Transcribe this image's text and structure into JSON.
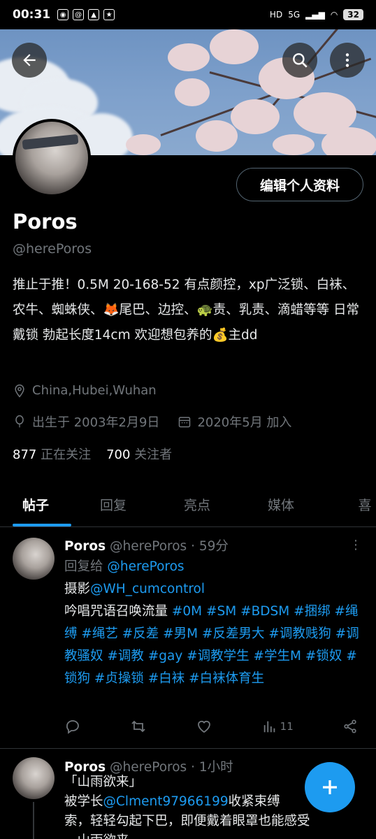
{
  "status_bar": {
    "time": "00:31",
    "network": "5G",
    "battery": "32"
  },
  "profile": {
    "edit_label": "编辑个人资料",
    "name": "Poros",
    "handle": "@herePoros",
    "bio": "推止于推！0.5M 20-168-52 有点颜控，xp广泛锁、白袜、农牛、蜘蛛侠、🦊尾巴、边控、🐢责、乳责、滴蜡等等 日常戴锁 勃起长度14cm 欢迎想包养的💰主dd",
    "location": "China,Hubei,Wuhan",
    "birthday": "出生于 2003年2月9日",
    "joined": "2020年5月 加入",
    "following_count": "877",
    "following_label": "正在关注",
    "followers_count": "700",
    "followers_label": "关注者"
  },
  "tabs": [
    {
      "label": "帖子"
    },
    {
      "label": "回复"
    },
    {
      "label": "亮点"
    },
    {
      "label": "媒体"
    },
    {
      "label": "喜"
    }
  ],
  "posts": [
    {
      "name": "Poros",
      "handle": "@herePoros",
      "time": "· 59分",
      "reply_prefix": "回复给 ",
      "reply_to": "@herePoros",
      "line1_text": "摄影",
      "line1_mention": "@WH_cumcontrol",
      "line2_text": "吟唱咒语召唤流量 ",
      "hashtags": "#0M #SM #BDSM #捆绑 #绳缚 #绳艺 #反差 #男M #反差男大 #调教贱狗 #调教骚奴 #调教 #gay #调教学生 #学生M #锁奴 #锁狗 #贞操锁 #白袜 #白袜体育生",
      "views": "11"
    },
    {
      "name": "Poros",
      "handle": "@herePoros",
      "time": "· 1小时",
      "line1": "「山雨欲来」",
      "line2_text": "被学长",
      "line2_mention": "@Clment97966199",
      "line2_rest": "收紧束缚",
      "line3": "索，轻轻勾起下巴，即便戴着眼罩也能感受",
      "line4": "…山雨欲来 …"
    }
  ]
}
